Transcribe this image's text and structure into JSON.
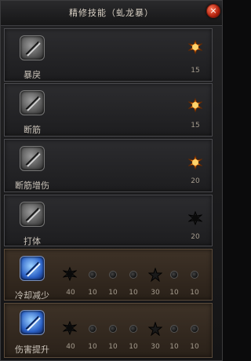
{
  "title": "精修技能（虬龙暴）",
  "close_label": "×",
  "skills": [
    {
      "label": "暴戾",
      "value": "15"
    },
    {
      "label": "断筋",
      "value": "15"
    },
    {
      "label": "断筋增伤",
      "value": "20"
    },
    {
      "label": "打体",
      "value": "20"
    },
    {
      "label": "冷却减少",
      "values": [
        "40",
        "10",
        "10",
        "10",
        "30",
        "10",
        "10"
      ]
    },
    {
      "label": "伤害提升",
      "values": [
        "40",
        "10",
        "10",
        "10",
        "30",
        "10",
        "10"
      ]
    }
  ],
  "colors": {
    "accent": "#e07818",
    "panel": "#141415",
    "brown_row": "#3e3227"
  }
}
